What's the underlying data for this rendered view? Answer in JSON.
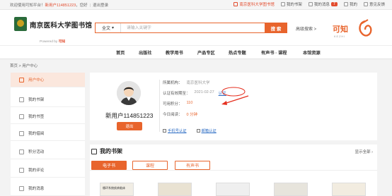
{
  "topbar": {
    "welcome": "欢迎使用可知平台！",
    "user": "新用户114851223",
    "greeting": "，您好",
    "logout": "退出登录",
    "links": [
      {
        "label": "南京医科大学图书馆",
        "icon": "building-icon",
        "accent": true
      },
      {
        "label": "我的书架",
        "icon": "book-icon",
        "accent": false
      },
      {
        "label": "我的消息",
        "icon": "mail-icon",
        "accent": false,
        "badge": "7"
      },
      {
        "label": "我的",
        "icon": "user-icon",
        "accent": false
      },
      {
        "label": "意见反馈",
        "icon": "feedback-icon",
        "accent": false
      }
    ]
  },
  "header": {
    "site_title": "南京医科大学图书馆",
    "powered_prefix": "Powered by",
    "powered_brand": "可知",
    "search_scope": "全文",
    "search_placeholder": "请输入关键字",
    "search_button": "搜 索",
    "advanced": "高级搜索 >",
    "brand_name": "可知",
    "brand_en": "KEZHI"
  },
  "nav": [
    "首页",
    "出版社",
    "教学用书",
    "产品专区",
    "热点专题",
    "有声书 · 课程",
    "本馆资源"
  ],
  "breadcrumb": "首页 > 用户中心",
  "sidebar": [
    {
      "label": "用户中心",
      "icon": "user-icon",
      "active": true
    },
    {
      "label": "我的书架",
      "icon": "bookshelf-icon",
      "active": false
    },
    {
      "label": "我的书签",
      "icon": "bookmark-icon",
      "active": false
    },
    {
      "label": "我的借阅",
      "icon": "borrow-icon",
      "active": false
    },
    {
      "label": "积分活动",
      "icon": "gift-icon",
      "active": false
    },
    {
      "label": "我的评论",
      "icon": "comment-icon",
      "active": false
    },
    {
      "label": "我的消息",
      "icon": "message-icon",
      "active": false
    }
  ],
  "profile": {
    "username": "新用户114851223",
    "logout_button": "退出",
    "org_label": "所属机构：",
    "org_value": "南京医科大学",
    "cert_label": "认证有效期至：",
    "cert_value": "2021-02-27",
    "cert_link": "认证",
    "points_label": "可用积分：",
    "points_value": "110",
    "reading_label": "今日阅读：",
    "reading_value": "0 分钟",
    "cert_options": [
      "手机号认证",
      "邮箱认证"
    ]
  },
  "shelf": {
    "title": "我的书架",
    "show_all": "显示全部",
    "tabs": [
      {
        "label": "电子书",
        "active": true
      },
      {
        "label": "课程",
        "active": false
      },
      {
        "label": "有声书",
        "active": false
      }
    ],
    "covers": [
      "循环系统疾病临床",
      "",
      "",
      ""
    ]
  },
  "colors": {
    "accent": "#e8642c",
    "link": "#2b6cc4",
    "annotation": "#e53020"
  }
}
